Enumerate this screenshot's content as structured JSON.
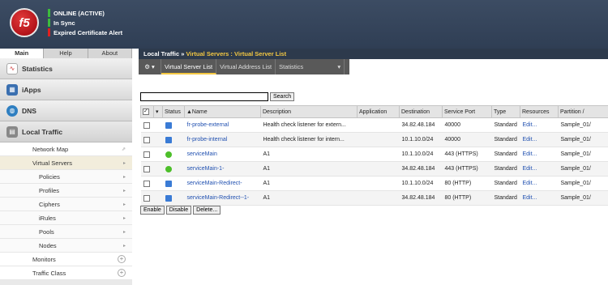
{
  "header": {
    "logo_text": "f5",
    "status": [
      {
        "text": "ONLINE (ACTIVE)",
        "color": "#3dbb3d"
      },
      {
        "text": "In Sync",
        "color": "#3dbb3d"
      },
      {
        "text": "Expired Certificate Alert",
        "color": "#e02020"
      }
    ]
  },
  "nav": {
    "tabs": [
      "Main",
      "Help",
      "About"
    ],
    "sections": [
      "Statistics",
      "iApps",
      "DNS",
      "Local Traffic"
    ],
    "local_traffic_items": [
      "Network Map",
      "Virtual Servers",
      "Policies",
      "Profiles",
      "Ciphers",
      "iRules",
      "Pools",
      "Nodes",
      "Monitors",
      "Traffic Class"
    ]
  },
  "main": {
    "breadcrumb_prefix": "Local Traffic",
    "breadcrumb_sep": " » ",
    "breadcrumb_current": "Virtual Servers : Virtual Server List",
    "subtabs": [
      "Virtual Server List",
      "Virtual Address List",
      "Statistics"
    ],
    "search_value": "",
    "search_button": "Search",
    "columns": [
      "Status",
      "▲Name",
      "Description",
      "Application",
      "Destination",
      "Service Port",
      "Type",
      "Resources",
      "Partition /"
    ],
    "rows": [
      {
        "status": "blue",
        "name": "fr-probe-external",
        "description": "Health check listener for extern...",
        "application": "",
        "destination": "34.82.48.184",
        "port": "40000",
        "type": "Standard",
        "resources": "Edit...",
        "partition": "Sample_01/"
      },
      {
        "status": "blue",
        "name": "fr-probe-internal",
        "description": "Health check listener for intern...",
        "application": "",
        "destination": "10.1.10.0/24",
        "port": "40000",
        "type": "Standard",
        "resources": "Edit...",
        "partition": "Sample_01/"
      },
      {
        "status": "green",
        "name": "serviceMain",
        "description": "A1",
        "application": "",
        "destination": "10.1.10.0/24",
        "port": "443 (HTTPS)",
        "type": "Standard",
        "resources": "Edit...",
        "partition": "Sample_01/"
      },
      {
        "status": "green",
        "name": "serviceMain-1-",
        "description": "A1",
        "application": "",
        "destination": "34.82.48.184",
        "port": "443 (HTTPS)",
        "type": "Standard",
        "resources": "Edit...",
        "partition": "Sample_01/"
      },
      {
        "status": "blue",
        "name": "serviceMain-Redirect-",
        "description": "A1",
        "application": "",
        "destination": "10.1.10.0/24",
        "port": "80 (HTTP)",
        "type": "Standard",
        "resources": "Edit...",
        "partition": "Sample_01/"
      },
      {
        "status": "blue",
        "name": "serviceMain-Redirect--1-",
        "description": "A1",
        "application": "",
        "destination": "34.82.48.184",
        "port": "80 (HTTP)",
        "type": "Standard",
        "resources": "Edit...",
        "partition": "Sample_01/"
      }
    ],
    "actions": [
      "Enable",
      "Disable",
      "Delete..."
    ]
  }
}
